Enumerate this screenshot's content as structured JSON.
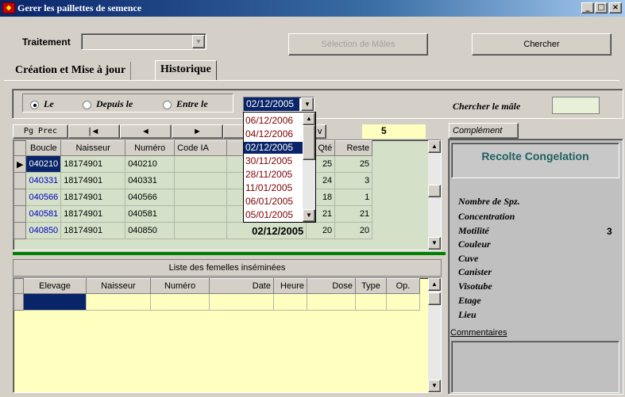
{
  "window": {
    "title": "Gerer les paillettes de semence",
    "controls": [
      "_",
      "□",
      "×"
    ]
  },
  "top": {
    "traitement_label": "Traitement",
    "traitement_value": "",
    "selection_males_label": "Sélection de Mâles",
    "chercher_label": "Chercher"
  },
  "tabs": [
    "Création et Mise à jour",
    "Historique"
  ],
  "filter": {
    "radio_le": "Le",
    "radio_depuis": "Depuis le",
    "radio_entre": "Entre le",
    "selected_date": "02/12/2005",
    "chercher_male_label": "Chercher le mâle",
    "male_value": ""
  },
  "date_dropdown": {
    "options": [
      "06/12/2006",
      "04/12/2006",
      "02/12/2005",
      "30/11/2005",
      "28/11/2005",
      "11/01/2005",
      "06/01/2005",
      "05/01/2005"
    ],
    "selected_index": 2
  },
  "nav": {
    "pg_prec": "Pg Prec",
    "first": "|◄",
    "prev": "◄",
    "next": "►",
    "last_partial": "v",
    "count": "5"
  },
  "grid1": {
    "columns": [
      "Boucle",
      "Naisseur",
      "Numéro",
      "Code IA",
      "",
      "Qté",
      "Reste"
    ],
    "rows": [
      {
        "boucle": "040210",
        "naisseur": "18174901",
        "numero": "040210",
        "code_ia": "",
        "date": "",
        "qte": "25",
        "reste": "25"
      },
      {
        "boucle": "040331",
        "naisseur": "18174901",
        "numero": "040331",
        "code_ia": "",
        "date": "",
        "qte": "24",
        "reste": "3"
      },
      {
        "boucle": "040566",
        "naisseur": "18174901",
        "numero": "040566",
        "code_ia": "",
        "date": "",
        "qte": "18",
        "reste": "1"
      },
      {
        "boucle": "040581",
        "naisseur": "18174901",
        "numero": "040581",
        "code_ia": "",
        "date": "",
        "qte": "21",
        "reste": "21"
      },
      {
        "boucle": "040850",
        "naisseur": "18174901",
        "numero": "040850",
        "code_ia": "",
        "date": "02/12/2005",
        "qte": "20",
        "reste": "20"
      }
    ]
  },
  "grid2": {
    "caption": "Liste des femelles inséminées",
    "columns": [
      "Elevage",
      "Naisseur",
      "Numéro",
      "Date",
      "Heure",
      "Dose",
      "Type",
      "Op."
    ]
  },
  "side": {
    "tab_label": "Complément",
    "title": "Recolte Congelation",
    "fields": [
      {
        "label": "Nombre de Spz.",
        "value": ""
      },
      {
        "label": "Concentration",
        "value": ""
      },
      {
        "label": "Motilité",
        "value": "3"
      },
      {
        "label": "Couleur",
        "value": ""
      },
      {
        "label": "Cuve",
        "value": ""
      },
      {
        "label": "Canister",
        "value": ""
      },
      {
        "label": "Visotube",
        "value": ""
      },
      {
        "label": "Etage",
        "value": ""
      },
      {
        "label": "Lieu",
        "value": ""
      }
    ],
    "comment_label": "Commentaires"
  }
}
